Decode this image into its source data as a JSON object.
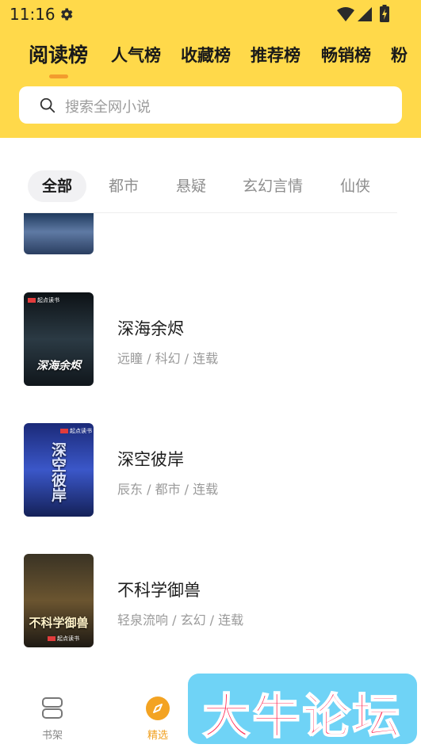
{
  "status_bar": {
    "time": "11:16"
  },
  "top_tabs": [
    {
      "label": "阅读榜",
      "active": true
    },
    {
      "label": "人气榜"
    },
    {
      "label": "收藏榜"
    },
    {
      "label": "推荐榜"
    },
    {
      "label": "畅销榜"
    },
    {
      "label": "粉"
    }
  ],
  "search": {
    "placeholder": "搜索全网小说"
  },
  "categories": [
    {
      "label": "全部",
      "active": true
    },
    {
      "label": "都市"
    },
    {
      "label": "悬疑"
    },
    {
      "label": "玄幻言情"
    },
    {
      "label": "仙侠"
    }
  ],
  "books": [
    {
      "title": "深海余烬",
      "meta": "远瞳 / 科幻 / 连载",
      "cover_text": "深海余烬",
      "cover_badge": "起点读书",
      "cover_colors": [
        "#0d1216",
        "#2b3a44",
        "#10161b"
      ]
    },
    {
      "title": "深空彼岸",
      "meta": "辰东 / 都市 / 连载",
      "cover_text": "深空彼岸",
      "cover_badge": "起点读书",
      "cover_colors": [
        "#1b2a78",
        "#3b57c9",
        "#142158"
      ]
    },
    {
      "title": "不科学御兽",
      "meta": "轻泉流响 / 玄幻 / 连载",
      "cover_text": "不科学御兽",
      "cover_badge": "起点读书",
      "cover_colors": [
        "#3a3324",
        "#6b5530",
        "#1e1a14"
      ]
    }
  ],
  "bottom_nav": [
    {
      "label": "书架",
      "icon": "bookshelf-icon",
      "active": false
    },
    {
      "label": "精选",
      "icon": "compass-icon",
      "active": true
    }
  ],
  "watermark": {
    "text": "大牛论坛"
  },
  "colors": {
    "header": "#ffd94a",
    "accent": "#f39c2e",
    "watermark_bg": "#6fd3f6",
    "watermark_text": "#ff2b56"
  }
}
